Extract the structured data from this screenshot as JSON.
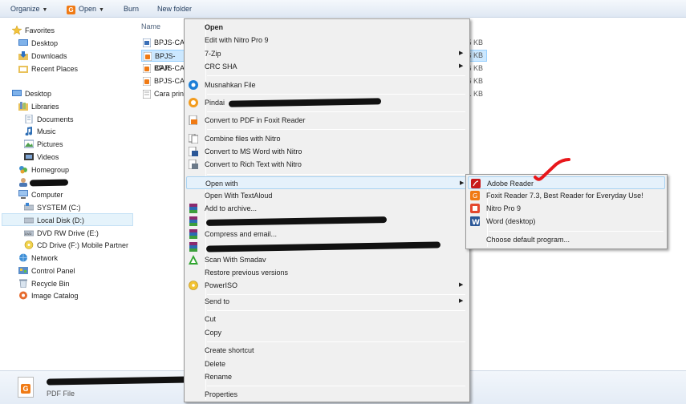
{
  "toolbar": {
    "organize": "Organize",
    "open": "Open",
    "burn": "Burn",
    "new_folder": "New folder"
  },
  "nav": {
    "favorites": "Favorites",
    "desktop_fav": "Desktop",
    "downloads": "Downloads",
    "recent_places": "Recent Places",
    "desktop": "Desktop",
    "libraries": "Libraries",
    "documents": "Documents",
    "music": "Music",
    "pictures": "Pictures",
    "videos": "Videos",
    "homegroup": "Homegroup",
    "computer": "Computer",
    "system_c": "SYSTEM (C:)",
    "local_d": "Local Disk (D:)",
    "dvd_e": "DVD RW Drive (E:)",
    "cd_f": "CD Drive (F:) Mobile Partner",
    "network": "Network",
    "control_panel": "Control Panel",
    "recycle_bin": "Recycle Bin",
    "image_catalog": "Image Catalog"
  },
  "content": {
    "col_name": "Name",
    "files": [
      {
        "name": "BPJS-CAR",
        "size": "5 KB"
      },
      {
        "name": "BPJS-CAR",
        "size": "6 KB"
      },
      {
        "name": "BPJS-CAR",
        "size": "6 KB"
      },
      {
        "name": "BPJS-CAR",
        "size": "6 KB"
      },
      {
        "name": "Cara print",
        "size": "1 KB"
      }
    ]
  },
  "details": {
    "type": "PDF File"
  },
  "context_menu": {
    "open": "Open",
    "edit_nitro": "Edit with Nitro Pro 9",
    "zip7": "7-Zip",
    "crc": "CRC SHA",
    "musnahkan": "Musnahkan File",
    "pindai": "Pindai",
    "foxit_convert": "Convert to PDF in Foxit Reader",
    "combine_nitro": "Combine files with Nitro",
    "convert_word": "Convert to MS Word with Nitro",
    "convert_rtf": "Convert to Rich Text with Nitro",
    "open_with": "Open with",
    "textaloud": "Open With TextAloud",
    "add_archive": "Add to archive...",
    "compress_email": "Compress and email...",
    "smadav": "Scan With Smadav",
    "restore": "Restore previous versions",
    "poweriso": "PowerISO",
    "send_to": "Send to",
    "cut": "Cut",
    "copy": "Copy",
    "create_shortcut": "Create shortcut",
    "delete": "Delete",
    "rename": "Rename",
    "properties": "Properties"
  },
  "open_with_menu": {
    "adobe": "Adobe Reader",
    "foxit": "Foxit Reader 7.3, Best Reader for Everyday Use!",
    "nitro": "Nitro Pro 9",
    "word": "Word (desktop)",
    "choose_default": "Choose default program..."
  },
  "colors": {
    "accent_selection": "#cce8ff",
    "menu_hover": "#e5f1fb",
    "red_mark": "#e8171b"
  }
}
